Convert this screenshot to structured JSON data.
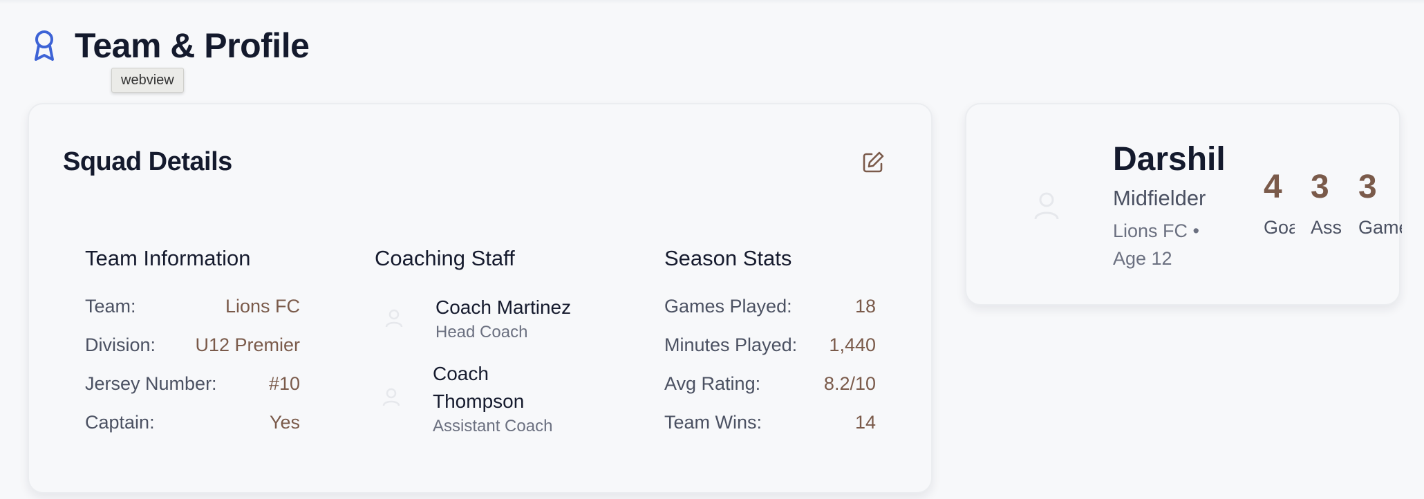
{
  "header": {
    "title": "Team & Profile",
    "tooltip": "webview"
  },
  "squad": {
    "title": "Squad Details",
    "team_info": {
      "title": "Team Information",
      "rows": [
        {
          "label": "Team:",
          "value": "Lions FC"
        },
        {
          "label": "Division:",
          "value": "U12 Premier"
        },
        {
          "label": "Jersey Number:",
          "value": "#10"
        },
        {
          "label": "Captain:",
          "value": "Yes"
        }
      ]
    },
    "coaching": {
      "title": "Coaching Staff",
      "coaches": [
        {
          "name": "Coach Martinez",
          "role": "Head Coach"
        },
        {
          "name_line1": "Coach",
          "name_line2": "Thompson",
          "role": "Assistant Coach"
        }
      ]
    },
    "season": {
      "title": "Season Stats",
      "rows": [
        {
          "label": "Games Played:",
          "value": "18"
        },
        {
          "label": "Minutes Played:",
          "value": "1,440"
        },
        {
          "label": "Avg Rating:",
          "value": "8.2/10"
        },
        {
          "label": "Team Wins:",
          "value": "14"
        }
      ]
    }
  },
  "profile": {
    "name": "Darshil",
    "position": "Midfielder",
    "meta_line1": "Lions FC •",
    "meta_line2": "Age 12",
    "stats": [
      {
        "value": "4",
        "label": "Goals"
      },
      {
        "value": "3",
        "label": "Assists"
      },
      {
        "value": "3",
        "label": "Games"
      }
    ]
  },
  "colors": {
    "accent": "#7a5a4a",
    "award_icon": "#3d63d6",
    "text": "#161b2e"
  }
}
